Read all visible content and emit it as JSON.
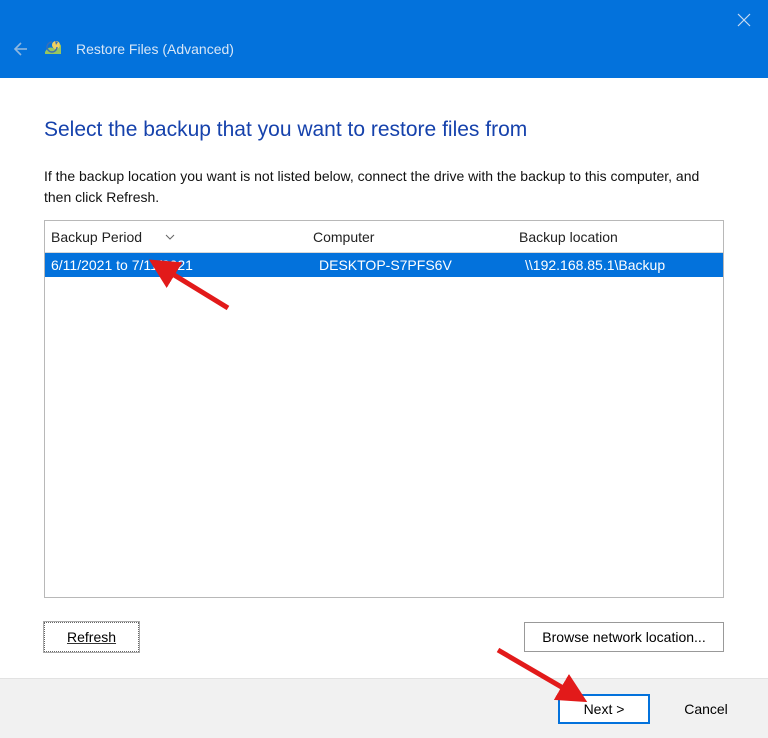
{
  "titlebar": {
    "title": "Restore Files (Advanced)"
  },
  "heading": "Select the backup that you want to restore files from",
  "instructions": "If the backup location you want is not listed below, connect the drive with the backup to this computer, and then click Refresh.",
  "table": {
    "headers": {
      "period": "Backup Period",
      "computer": "Computer",
      "location": "Backup location"
    },
    "rows": [
      {
        "period": "6/11/2021 to 7/11/2021",
        "computer": "DESKTOP-S7PFS6V",
        "location": "\\\\192.168.85.1\\Backup"
      }
    ]
  },
  "buttons": {
    "refresh": "Refresh",
    "browse": "Browse network location...",
    "next": "Next >",
    "cancel": "Cancel"
  }
}
